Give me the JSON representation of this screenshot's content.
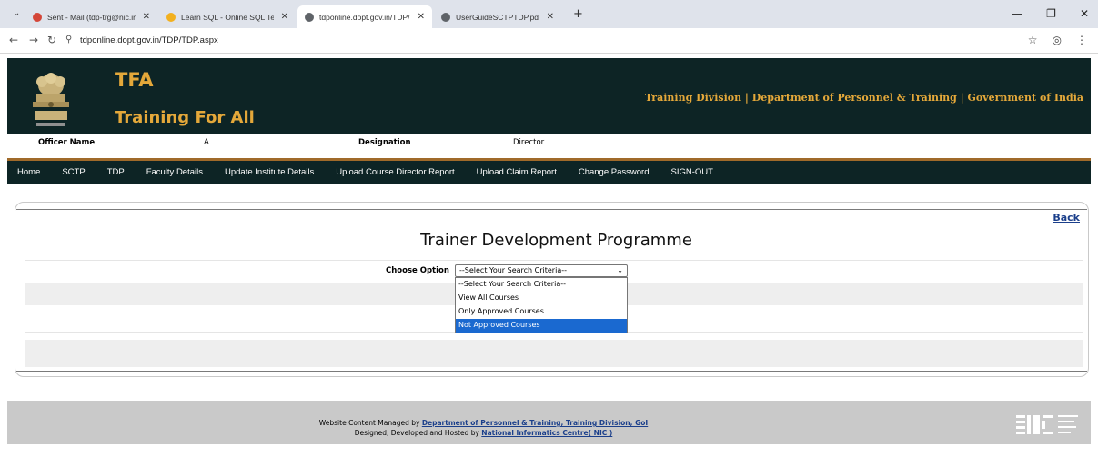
{
  "browser": {
    "tabs": [
      {
        "label": "Sent - Mail (tdp-trg@nic.in)",
        "favicon_color": "#d44638"
      },
      {
        "label": "Learn SQL - Online SQL Termin",
        "favicon_color": "#f2b01e"
      },
      {
        "label": "tdponline.dopt.gov.in/TDP/TDF",
        "favicon_color": "#5f6368"
      },
      {
        "label": "UserGuideSCTPTDP.pdf",
        "favicon_color": "#5f6368"
      }
    ],
    "url": "tdponline.dopt.gov.in/TDP/TDP.aspx"
  },
  "header": {
    "brand_title": "TFA",
    "brand_subtitle": "Training For All",
    "department": "Training Division | Department of Personnel & Training | Government of India"
  },
  "officer": {
    "name_label": "Officer Name",
    "name_value": "A",
    "designation_label": "Designation",
    "designation_value": "Director"
  },
  "menu": [
    "Home",
    "SCTP",
    "TDP",
    "Faculty Details",
    "Update Institute Details",
    "Upload Course Director Report",
    "Upload Claim Report",
    "Change Password",
    "SIGN-OUT"
  ],
  "main": {
    "back_label": "Back",
    "page_title": "Trainer Development Programme",
    "choose_label": "Choose Option",
    "select_value": "--Select Your Search Criteria--",
    "options": [
      {
        "label": "--Select Your Search Criteria--",
        "selected": false
      },
      {
        "label": "View All Courses",
        "selected": false
      },
      {
        "label": "Only Approved Courses",
        "selected": false
      },
      {
        "label": "Not Approved Courses",
        "selected": true
      }
    ]
  },
  "footer": {
    "line1_prefix": "Website Content Managed by ",
    "line1_link": "Department of Personnel & Training, Training Division, GoI",
    "line2_prefix": "Designed, Developed and Hosted by ",
    "line2_link": "National Informatics Centre( NIC )"
  },
  "colors": {
    "header_bg": "#0d2425",
    "accent_gold": "#e4a83a",
    "selected_option": "#1a69d0",
    "link_blue": "#1b3f8b"
  }
}
